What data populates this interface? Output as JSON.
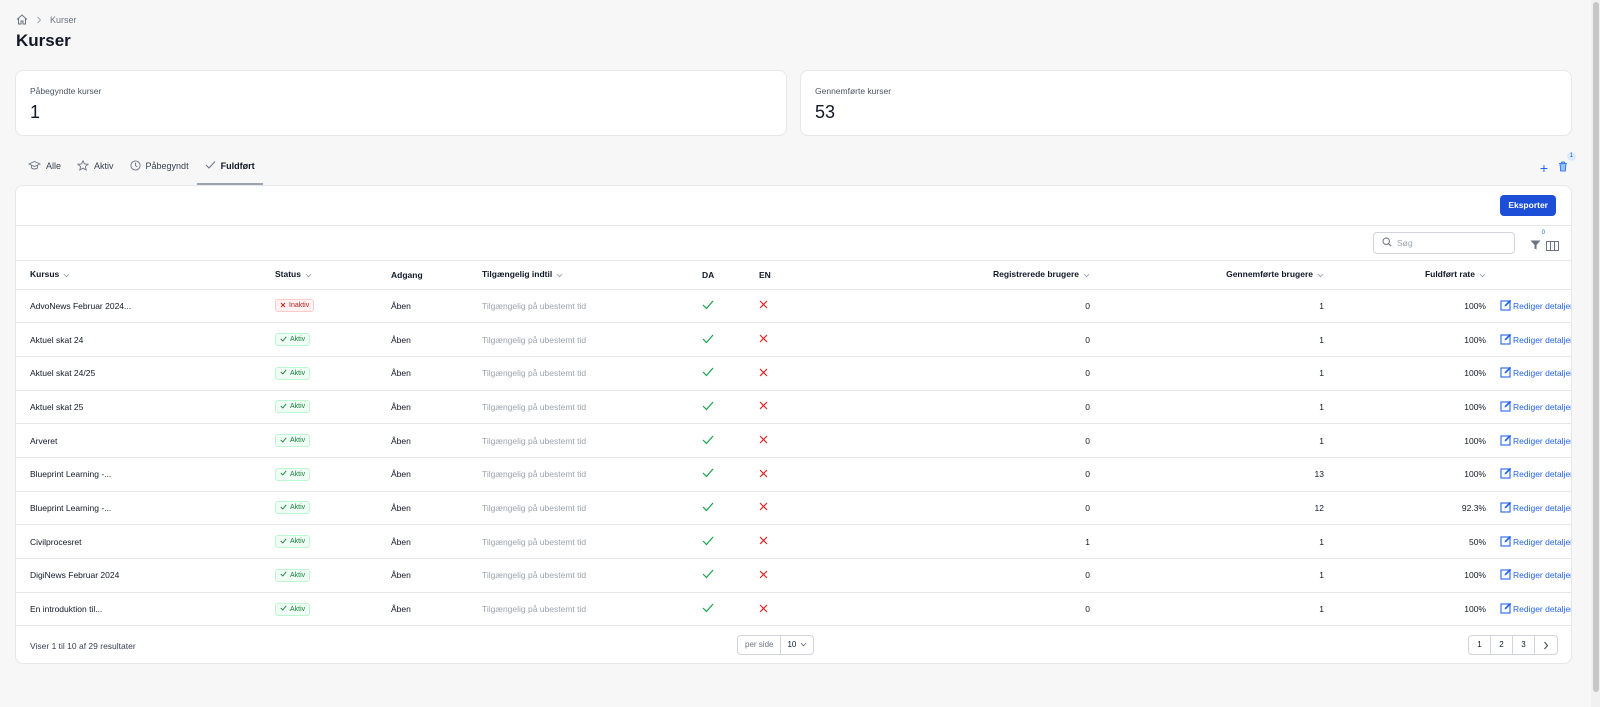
{
  "breadcrumb": {
    "current": "Kurser"
  },
  "page": {
    "title": "Kurser"
  },
  "stats": [
    {
      "label": "Påbegyndte kurser",
      "value": "1"
    },
    {
      "label": "Gennemførte kurser",
      "value": "53"
    }
  ],
  "tabs": [
    {
      "label": "Alle"
    },
    {
      "label": "Aktiv"
    },
    {
      "label": "Påbegyndt"
    },
    {
      "label": "Fuldført"
    }
  ],
  "toolbar": {
    "trash_count": "1",
    "export_label": "Eksporter",
    "search_placeholder": "Søg",
    "filter_count": "0"
  },
  "table": {
    "columns": [
      "Kursus",
      "Status",
      "Adgang",
      "Tilgængelig indtil",
      "DA",
      "EN",
      "Registrerede brugere",
      "Gennemførte brugere",
      "Fuldført rate"
    ],
    "edit_label": "Rediger detaljer",
    "rows": [
      {
        "kursus": "AdvoNews Februar 2024...",
        "status": "Inaktiv",
        "adgang": "Åben",
        "til": "Tilgængelig på ubestemt tid",
        "reg": "0",
        "done": "1",
        "rate": "100%"
      },
      {
        "kursus": "Aktuel skat 24",
        "status": "Aktiv",
        "adgang": "Åben",
        "til": "Tilgængelig på ubestemt tid",
        "reg": "0",
        "done": "1",
        "rate": "100%"
      },
      {
        "kursus": "Aktuel skat 24/25",
        "status": "Aktiv",
        "adgang": "Åben",
        "til": "Tilgængelig på ubestemt tid",
        "reg": "0",
        "done": "1",
        "rate": "100%"
      },
      {
        "kursus": "Aktuel skat 25",
        "status": "Aktiv",
        "adgang": "Åben",
        "til": "Tilgængelig på ubestemt tid",
        "reg": "0",
        "done": "1",
        "rate": "100%"
      },
      {
        "kursus": "Arveret",
        "status": "Aktiv",
        "adgang": "Åben",
        "til": "Tilgængelig på ubestemt tid",
        "reg": "0",
        "done": "1",
        "rate": "100%"
      },
      {
        "kursus": "Blueprint Learning -...",
        "status": "Aktiv",
        "adgang": "Åben",
        "til": "Tilgængelig på ubestemt tid",
        "reg": "0",
        "done": "13",
        "rate": "100%"
      },
      {
        "kursus": "Blueprint Learning -...",
        "status": "Aktiv",
        "adgang": "Åben",
        "til": "Tilgængelig på ubestemt tid",
        "reg": "0",
        "done": "12",
        "rate": "92.3%"
      },
      {
        "kursus": "Civilprocesret",
        "status": "Aktiv",
        "adgang": "Åben",
        "til": "Tilgængelig på ubestemt tid",
        "reg": "1",
        "done": "1",
        "rate": "50%"
      },
      {
        "kursus": "DigiNews Februar 2024",
        "status": "Aktiv",
        "adgang": "Åben",
        "til": "Tilgængelig på ubestemt tid",
        "reg": "0",
        "done": "1",
        "rate": "100%"
      },
      {
        "kursus": "En introduktion til...",
        "status": "Aktiv",
        "adgang": "Åben",
        "til": "Tilgængelig på ubestemt tid",
        "reg": "0",
        "done": "1",
        "rate": "100%"
      }
    ]
  },
  "footer": {
    "results": "Viser 1 til 10 af 29 resultater",
    "per_page_label": "per side",
    "per_page_value": "10",
    "pages": [
      "1",
      "2",
      "3"
    ]
  },
  "colors": {
    "accent": "#1d4ed8",
    "success": "#16a34a",
    "danger": "#dc2626"
  }
}
